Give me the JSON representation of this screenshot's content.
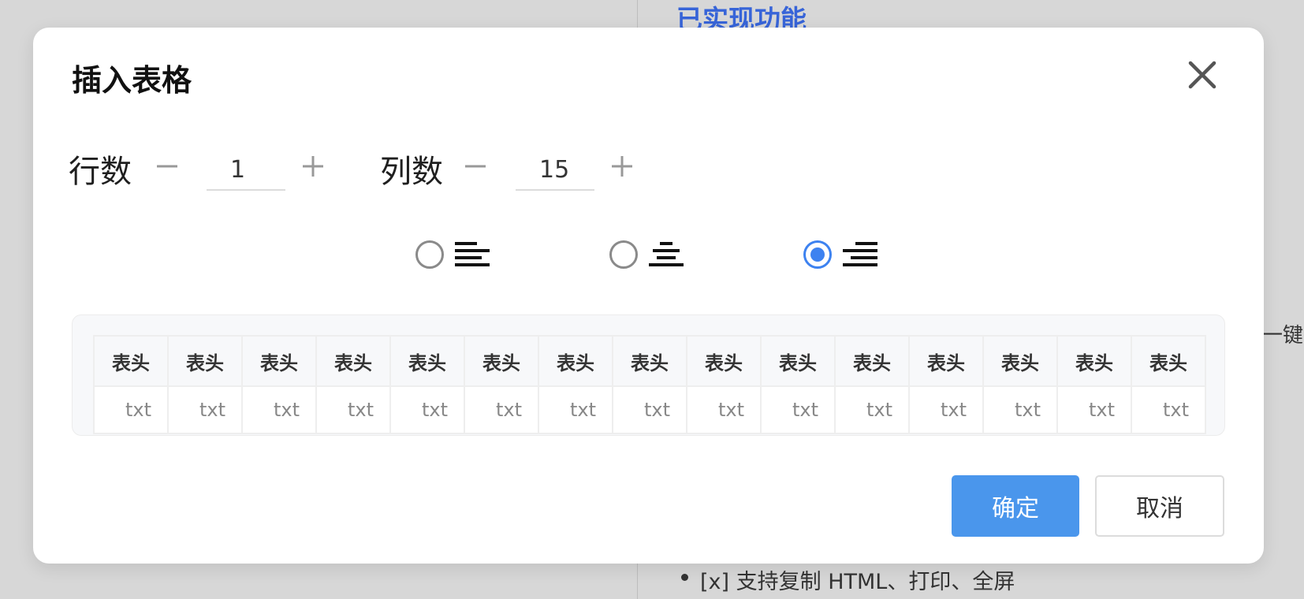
{
  "background": {
    "heading": "已实现功能",
    "side_text": "一键",
    "list_item": "[x] 支持复制 HTML、打印、全屏"
  },
  "dialog": {
    "title": "插入表格",
    "close_icon": "close-icon",
    "rows": {
      "label": "行数",
      "value": "1",
      "decrement": "minus-icon",
      "increment": "plus-icon"
    },
    "cols": {
      "label": "列数",
      "value": "15",
      "decrement": "minus-icon",
      "increment": "plus-icon"
    },
    "alignment": {
      "options": [
        "align-left-icon",
        "align-center-icon",
        "align-right-icon"
      ],
      "selected": "align-right-icon"
    },
    "preview": {
      "headers": [
        "表头",
        "表头",
        "表头",
        "表头",
        "表头",
        "表头",
        "表头",
        "表头",
        "表头",
        "表头",
        "表头",
        "表头",
        "表头",
        "表头",
        "表头"
      ],
      "cells": [
        "txt",
        "txt",
        "txt",
        "txt",
        "txt",
        "txt",
        "txt",
        "txt",
        "txt",
        "txt",
        "txt",
        "txt",
        "txt",
        "txt",
        "txt"
      ]
    },
    "confirm_label": "确定",
    "cancel_label": "取消"
  },
  "colors": {
    "accent": "#3d82f0",
    "confirm_bg": "#4a96ec",
    "link": "#3764d8"
  }
}
